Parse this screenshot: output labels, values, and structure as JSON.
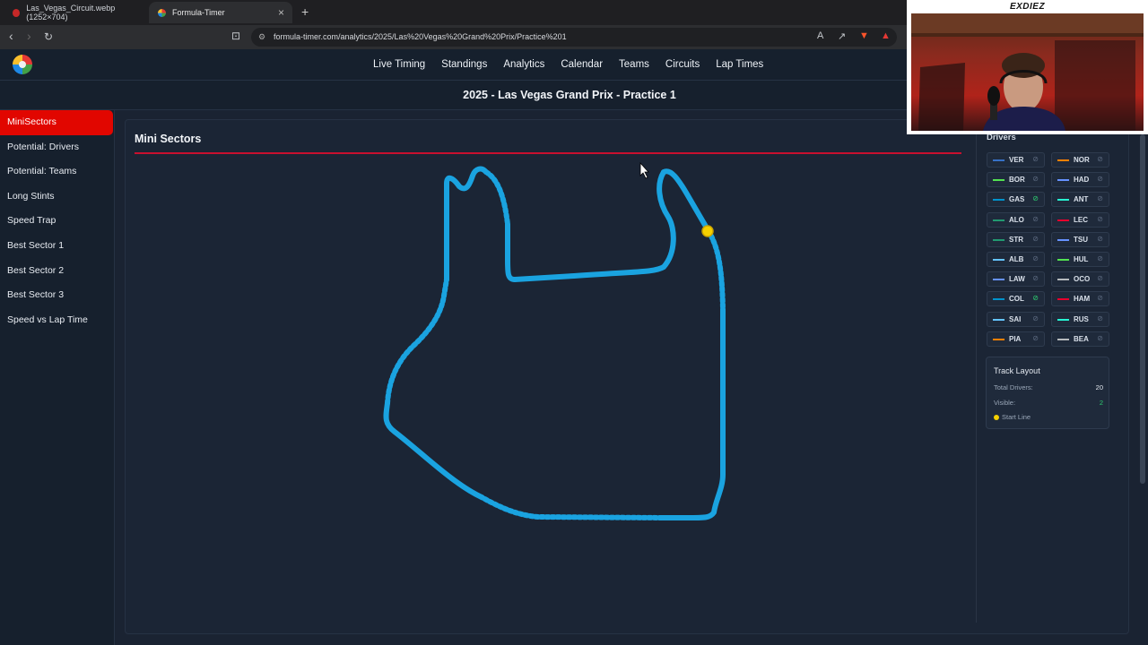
{
  "browser": {
    "tabs": [
      {
        "title": "Las_Vegas_Circuit.webp (1252×704)",
        "active": false
      },
      {
        "title": "Formula-Timer",
        "active": true
      }
    ],
    "url": "formula-timer.com/analytics/2025/Las%20Vegas%20Grand%20Prix/Practice%201"
  },
  "nav": {
    "items": [
      "Live Timing",
      "Standings",
      "Analytics",
      "Calendar",
      "Teams",
      "Circuits",
      "Lap Times"
    ]
  },
  "page_title": "2025 - Las Vegas Grand Prix - Practice 1",
  "sidebar": {
    "items": [
      {
        "label": "MiniSectors",
        "active": true
      },
      {
        "label": "Potential: Drivers",
        "active": false
      },
      {
        "label": "Potential: Teams",
        "active": false
      },
      {
        "label": "Long Stints",
        "active": false
      },
      {
        "label": "Speed Trap",
        "active": false
      },
      {
        "label": "Best Sector 1",
        "active": false
      },
      {
        "label": "Best Sector 2",
        "active": false
      },
      {
        "label": "Best Sector 3",
        "active": false
      },
      {
        "label": "Speed vs Lap Time",
        "active": false
      }
    ]
  },
  "panel": {
    "title": "Mini Sectors"
  },
  "track": {
    "color": "#1aa3e0",
    "start_marker_color": "#f5d000"
  },
  "drivers": {
    "label": "Drivers",
    "list": [
      {
        "code": "VER",
        "color": "#3671c6"
      },
      {
        "code": "NOR",
        "color": "#ff8000"
      },
      {
        "code": "BOR",
        "color": "#52e252"
      },
      {
        "code": "HAD",
        "color": "#6692ff"
      },
      {
        "code": "GAS",
        "color": "#0093cc"
      },
      {
        "code": "ANT",
        "color": "#27f4d2"
      },
      {
        "code": "ALO",
        "color": "#229971"
      },
      {
        "code": "LEC",
        "color": "#e8002d"
      },
      {
        "code": "STR",
        "color": "#229971"
      },
      {
        "code": "TSU",
        "color": "#6692ff"
      },
      {
        "code": "ALB",
        "color": "#64c4ff"
      },
      {
        "code": "HUL",
        "color": "#52e252"
      },
      {
        "code": "LAW",
        "color": "#6692ff"
      },
      {
        "code": "OCO",
        "color": "#b6babd"
      },
      {
        "code": "COL",
        "color": "#0093cc"
      },
      {
        "code": "HAM",
        "color": "#e8002d"
      },
      {
        "code": "SAI",
        "color": "#64c4ff"
      },
      {
        "code": "RUS",
        "color": "#27f4d2"
      },
      {
        "code": "PIA",
        "color": "#ff8000"
      },
      {
        "code": "BEA",
        "color": "#b6babd"
      }
    ]
  },
  "track_layout": {
    "title": "Track Layout",
    "total_label": "Total Drivers:",
    "total_value": "20",
    "visible_label": "Visible:",
    "visible_value": "2",
    "start_label": "Start Line"
  },
  "webcam": {
    "name": "EXDIEZ"
  }
}
